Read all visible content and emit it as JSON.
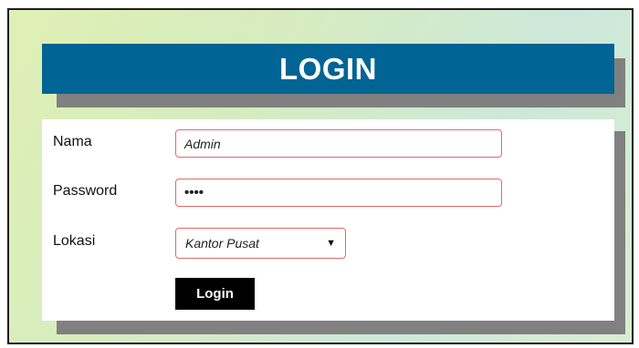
{
  "header": {
    "title": "LOGIN"
  },
  "form": {
    "name_label": "Nama",
    "name_value": "Admin",
    "password_label": "Password",
    "password_value": "••••",
    "location_label": "Lokasi",
    "location_selected": "Kantor Pusat",
    "submit_label": "Login"
  },
  "colors": {
    "title_bar": "#006494",
    "shadow": "#808080",
    "field_border": "#e06a6a",
    "button": "#000000"
  }
}
